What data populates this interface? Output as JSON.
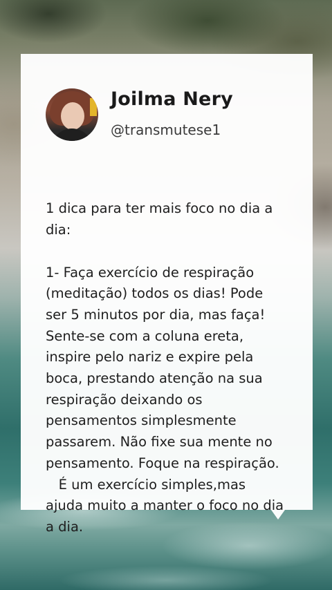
{
  "post": {
    "author_name": "Joilma Nery",
    "author_handle": "@transmutese1",
    "avatar_icon": "profile-photo",
    "lines": [
      "1 dica para ter mais foco no dia a",
      "dia:",
      "",
      "1- Faça exercício de respiração",
      "(meditação) todos os dias! Pode",
      "ser 5 minutos por dia, mas faça!",
      "Sente-se com a coluna ereta,",
      "inspire pelo nariz e expire pela",
      "boca, prestando atenção na sua",
      "respiração deixando os",
      "pensamentos simplesmente",
      "passarem. Não fixe sua mente no",
      "pensamento. Foque na respiração.",
      "   É um exercício simples,mas",
      "ajuda muito a manter o foco no dia",
      "a dia."
    ]
  }
}
